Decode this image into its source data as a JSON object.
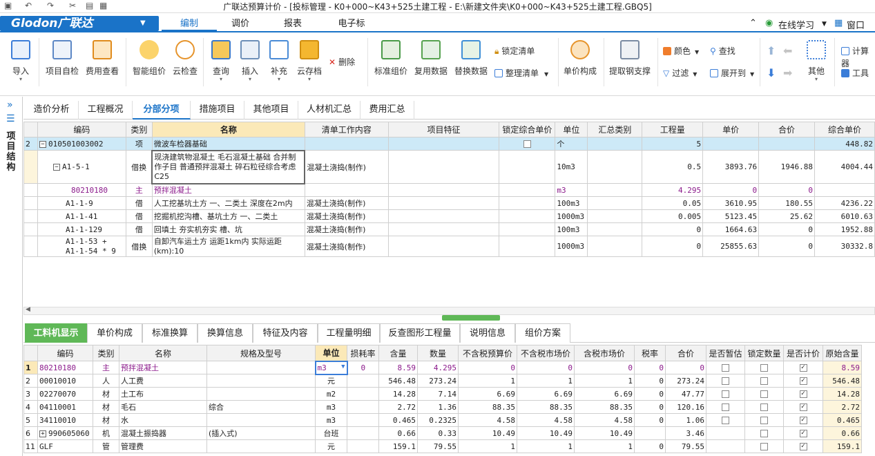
{
  "title_bar": {
    "title": "广联达预算计价 - [投标管理 - K0+000~K43+525土建工程 - E:\\新建文件夹\\K0+000~K43+525土建工程.GBQ5]"
  },
  "menu": {
    "logo": "Glodon广联达",
    "tabs": [
      "编制",
      "调价",
      "报表",
      "电子标"
    ],
    "online": "在线学习",
    "window": "窗口"
  },
  "ribbon": {
    "buttons": [
      "导入",
      "项目自检",
      "费用查看",
      "智能组价",
      "云检查",
      "查询",
      "插入",
      "补充",
      "云存档",
      "标准组价",
      "复用数据",
      "替换数据",
      "单价构成",
      "提取钢支撑",
      "其他"
    ],
    "small": [
      "删除",
      "锁定清单",
      "整理清单",
      "颜色",
      "查找",
      "过滤",
      "展开到",
      "计算器",
      "工具"
    ]
  },
  "left_label": "项目结构",
  "page_tabs": [
    "造价分析",
    "工程概况",
    "分部分项",
    "措施项目",
    "其他项目",
    "人材机汇总",
    "费用汇总"
  ],
  "top_grid": {
    "headers": [
      "编码",
      "类别",
      "名称",
      "清单工作内容",
      "项目特征",
      "锁定综合单价",
      "单位",
      "汇总类别",
      "工程量",
      "单价",
      "合价",
      "综合单价"
    ],
    "rows": [
      {
        "idx": "2",
        "code": "010501003002",
        "type": "项",
        "name": "微波车检器基础",
        "content": "",
        "feat": "",
        "unit": "个",
        "qty": "5",
        "price": "",
        "total": "",
        "comp": "448.82"
      },
      {
        "idx": "",
        "code": "A1-5-1",
        "type": "借换",
        "name": "现浇建筑物混凝土 毛石混凝土基础 合并制作子目 普通预拌混凝土 碎石粒径综合考虑 C25",
        "content": "混凝土浇捣(制作)",
        "feat": "",
        "unit": "10m3",
        "qty": "0.5",
        "price": "3893.76",
        "total": "1946.88",
        "comp": "4004.44"
      },
      {
        "idx": "",
        "code": "80210180",
        "type": "主",
        "name": "预拌混凝土",
        "content": "",
        "feat": "",
        "unit": "m3",
        "qty": "4.295",
        "price": "0",
        "total": "0",
        "comp": ""
      },
      {
        "idx": "",
        "code": "A1-1-9",
        "type": "借",
        "name": "人工挖基坑土方 一、二类土 深度在2m内",
        "content": "混凝土浇捣(制作)",
        "feat": "",
        "unit": "100m3",
        "qty": "0.05",
        "price": "3610.95",
        "total": "180.55",
        "comp": "4236.22"
      },
      {
        "idx": "",
        "code": "A1-1-41",
        "type": "借",
        "name": "挖掘机挖沟槽、基坑土方 一、二类土",
        "content": "混凝土浇捣(制作)",
        "feat": "",
        "unit": "1000m3",
        "qty": "0.005",
        "price": "5123.45",
        "total": "25.62",
        "comp": "6010.63"
      },
      {
        "idx": "",
        "code": "A1-1-129",
        "type": "借",
        "name": "回填土 夯实机夯实 槽、坑",
        "content": "混凝土浇捣(制作)",
        "feat": "",
        "unit": "100m3",
        "qty": "0",
        "price": "1664.63",
        "total": "0",
        "comp": "1952.88"
      },
      {
        "idx": "",
        "code": "A1-1-53 + A1-1-54 * 9",
        "type": "借换",
        "name": "自卸汽车运土方 运距1km内 实际运距(km):10",
        "content": "混凝土浇捣(制作)",
        "feat": "",
        "unit": "1000m3",
        "qty": "0",
        "price": "25855.63",
        "total": "0",
        "comp": "30332.8"
      }
    ]
  },
  "bottom_tabs": [
    "工料机显示",
    "单价构成",
    "标准换算",
    "换算信息",
    "特征及内容",
    "工程量明细",
    "反查图形工程量",
    "说明信息",
    "组价方案"
  ],
  "bottom_grid": {
    "headers": [
      "编码",
      "类别",
      "名称",
      "规格及型号",
      "单位",
      "损耗率",
      "含量",
      "数量",
      "不含税预算价",
      "不含税市场价",
      "含税市场价",
      "税率",
      "合价",
      "是否暂估",
      "锁定数量",
      "是否计价",
      "原始含量"
    ],
    "rows": [
      {
        "rn": "1",
        "code": "80210180",
        "type": "主",
        "name": "预拌混凝土",
        "spec": "",
        "unit": "m3",
        "loss": "0",
        "content": "8.59",
        "qty": "4.295",
        "p1": "0",
        "p2": "0",
        "p3": "0",
        "tax": "0",
        "total": "0",
        "orig": "8.59"
      },
      {
        "rn": "2",
        "code": "00010010",
        "type": "人",
        "name": "人工费",
        "spec": "",
        "unit": "元",
        "loss": "",
        "content": "546.48",
        "qty": "273.24",
        "p1": "1",
        "p2": "1",
        "p3": "1",
        "tax": "0",
        "total": "273.24",
        "orig": "546.48"
      },
      {
        "rn": "3",
        "code": "02270070",
        "type": "材",
        "name": "土工布",
        "spec": "",
        "unit": "m2",
        "loss": "",
        "content": "14.28",
        "qty": "7.14",
        "p1": "6.69",
        "p2": "6.69",
        "p3": "6.69",
        "tax": "0",
        "total": "47.77",
        "orig": "14.28"
      },
      {
        "rn": "4",
        "code": "04110001",
        "type": "材",
        "name": "毛石",
        "spec": "综合",
        "unit": "m3",
        "loss": "",
        "content": "2.72",
        "qty": "1.36",
        "p1": "88.35",
        "p2": "88.35",
        "p3": "88.35",
        "tax": "0",
        "total": "120.16",
        "orig": "2.72"
      },
      {
        "rn": "5",
        "code": "34110010",
        "type": "材",
        "name": "水",
        "spec": "",
        "unit": "m3",
        "loss": "",
        "content": "0.465",
        "qty": "0.2325",
        "p1": "4.58",
        "p2": "4.58",
        "p3": "4.58",
        "tax": "0",
        "total": "1.06",
        "orig": "0.465"
      },
      {
        "rn": "6",
        "code": "990605060",
        "type": "机",
        "name": "混凝土振捣器",
        "spec": "(插入式)",
        "unit": "台班",
        "loss": "",
        "content": "0.66",
        "qty": "0.33",
        "p1": "10.49",
        "p2": "10.49",
        "p3": "10.49",
        "tax": "",
        "total": "3.46",
        "orig": "0.66"
      },
      {
        "rn": "11",
        "code": "GLF",
        "type": "管",
        "name": "管理费",
        "spec": "",
        "unit": "元",
        "loss": "",
        "content": "159.1",
        "qty": "79.55",
        "p1": "1",
        "p2": "1",
        "p3": "1",
        "tax": "0",
        "total": "79.55",
        "orig": "159.1"
      }
    ]
  }
}
